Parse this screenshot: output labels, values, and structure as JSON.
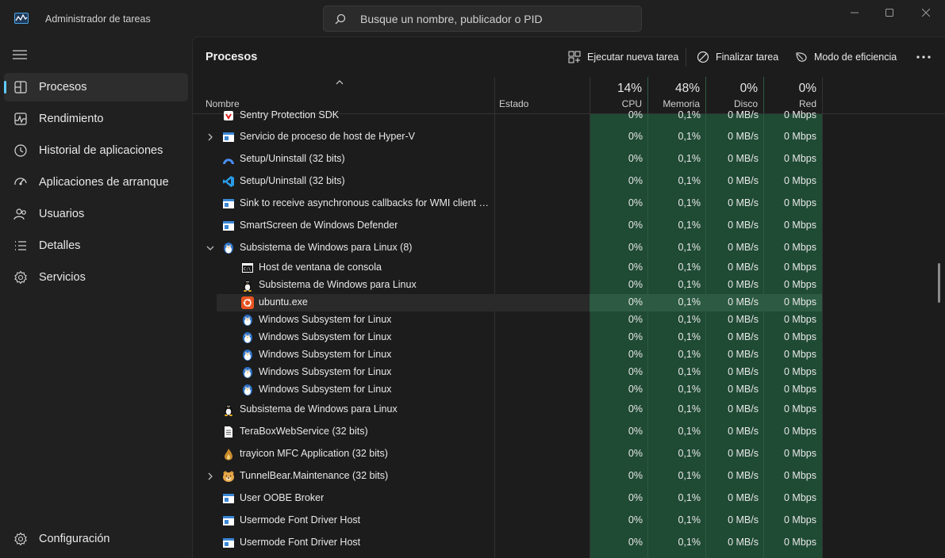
{
  "window": {
    "title": "Administrador de tareas",
    "search_placeholder": "Busque un nombre, publicador o PID"
  },
  "sidebar": {
    "items": [
      {
        "label": "Procesos",
        "icon": "processes-icon",
        "active": true
      },
      {
        "label": "Rendimiento",
        "icon": "performance-icon"
      },
      {
        "label": "Historial de aplicaciones",
        "icon": "app-history-icon"
      },
      {
        "label": "Aplicaciones de arranque",
        "icon": "startup-apps-icon"
      },
      {
        "label": "Usuarios",
        "icon": "users-icon"
      },
      {
        "label": "Detalles",
        "icon": "details-icon"
      },
      {
        "label": "Servicios",
        "icon": "services-icon"
      }
    ],
    "settings_label": "Configuración"
  },
  "toolbar": {
    "title": "Procesos",
    "run_task": "Ejecutar nueva tarea",
    "end_task": "Finalizar tarea",
    "efficiency": "Modo de eficiencia"
  },
  "columns": {
    "name": "Nombre",
    "status": "Estado",
    "cpu": {
      "pct": "14%",
      "label": "CPU"
    },
    "memory": {
      "pct": "48%",
      "label": "Memoria"
    },
    "disk": {
      "pct": "0%",
      "label": "Disco"
    },
    "network": {
      "pct": "0%",
      "label": "Red"
    }
  },
  "rows": [
    {
      "name": "Sentry Protection SDK",
      "icon": "sentry-icon",
      "level": 0,
      "cpu": "0%",
      "mem": "0,1%",
      "disk": "0 MB/s",
      "net": "0 Mbps"
    },
    {
      "name": "Servicio de proceso de host de Hyper-V",
      "icon": "service-window-icon",
      "level": 0,
      "expand": "collapsed",
      "cpu": "0%",
      "mem": "0,1%",
      "disk": "0 MB/s",
      "net": "0 Mbps"
    },
    {
      "name": "Setup/Uninstall (32 bits)",
      "icon": "setup-arc-icon",
      "level": 0,
      "cpu": "0%",
      "mem": "0,1%",
      "disk": "0 MB/s",
      "net": "0 Mbps"
    },
    {
      "name": "Setup/Uninstall (32 bits)",
      "icon": "vscode-icon",
      "level": 0,
      "cpu": "0%",
      "mem": "0,1%",
      "disk": "0 MB/s",
      "net": "0 Mbps"
    },
    {
      "name": "Sink to receive asynchronous callbacks for WMI client app...",
      "icon": "service-window-icon",
      "level": 0,
      "cpu": "0%",
      "mem": "0,1%",
      "disk": "0 MB/s",
      "net": "0 Mbps"
    },
    {
      "name": "SmartScreen de Windows Defender",
      "icon": "service-window-icon",
      "level": 0,
      "cpu": "0%",
      "mem": "0,1%",
      "disk": "0 MB/s",
      "net": "0 Mbps"
    },
    {
      "name": "Subsistema de Windows para Linux (8)",
      "icon": "penguin-icon",
      "level": 0,
      "expand": "expanded",
      "cpu": "0%",
      "mem": "0,1%",
      "disk": "0 MB/s",
      "net": "0 Mbps"
    },
    {
      "name": "Host de ventana de consola",
      "icon": "console-icon",
      "level": 1,
      "cpu": "0%",
      "mem": "0,1%",
      "disk": "0 MB/s",
      "net": "0 Mbps"
    },
    {
      "name": "Subsistema de Windows para Linux",
      "icon": "linux-tux-icon",
      "level": 1,
      "cpu": "0%",
      "mem": "0,1%",
      "disk": "0 MB/s",
      "net": "0 Mbps"
    },
    {
      "name": "ubuntu.exe",
      "icon": "ubuntu-icon",
      "level": 1,
      "highlight": true,
      "cpu": "0%",
      "mem": "0,1%",
      "disk": "0 MB/s",
      "net": "0 Mbps"
    },
    {
      "name": "Windows Subsystem for Linux",
      "icon": "penguin-icon",
      "level": 1,
      "cpu": "0%",
      "mem": "0,1%",
      "disk": "0 MB/s",
      "net": "0 Mbps"
    },
    {
      "name": "Windows Subsystem for Linux",
      "icon": "penguin-icon",
      "level": 1,
      "cpu": "0%",
      "mem": "0,1%",
      "disk": "0 MB/s",
      "net": "0 Mbps"
    },
    {
      "name": "Windows Subsystem for Linux",
      "icon": "penguin-icon",
      "level": 1,
      "cpu": "0%",
      "mem": "0,1%",
      "disk": "0 MB/s",
      "net": "0 Mbps"
    },
    {
      "name": "Windows Subsystem for Linux",
      "icon": "penguin-icon",
      "level": 1,
      "cpu": "0%",
      "mem": "0,1%",
      "disk": "0 MB/s",
      "net": "0 Mbps"
    },
    {
      "name": "Windows Subsystem for Linux",
      "icon": "penguin-icon",
      "level": 1,
      "cpu": "0%",
      "mem": "0,1%",
      "disk": "0 MB/s",
      "net": "0 Mbps"
    },
    {
      "name": "Subsistema de Windows para Linux",
      "icon": "linux-tux-icon",
      "level": 0,
      "cpu": "0%",
      "mem": "0,1%",
      "disk": "0 MB/s",
      "net": "0 Mbps"
    },
    {
      "name": "TeraBoxWebService (32 bits)",
      "icon": "document-icon",
      "level": 0,
      "cpu": "0%",
      "mem": "0,1%",
      "disk": "0 MB/s",
      "net": "0 Mbps"
    },
    {
      "name": "trayicon MFC Application (32 bits)",
      "icon": "flame-icon",
      "level": 0,
      "cpu": "0%",
      "mem": "0,1%",
      "disk": "0 MB/s",
      "net": "0 Mbps"
    },
    {
      "name": "TunnelBear.Maintenance (32 bits)",
      "icon": "tunnelbear-icon",
      "level": 0,
      "expand": "collapsed",
      "cpu": "0%",
      "mem": "0,1%",
      "disk": "0 MB/s",
      "net": "0 Mbps"
    },
    {
      "name": "User OOBE Broker",
      "icon": "service-window-icon",
      "level": 0,
      "cpu": "0%",
      "mem": "0,1%",
      "disk": "0 MB/s",
      "net": "0 Mbps"
    },
    {
      "name": "Usermode Font Driver Host",
      "icon": "service-window-icon",
      "level": 0,
      "cpu": "0%",
      "mem": "0,1%",
      "disk": "0 MB/s",
      "net": "0 Mbps"
    },
    {
      "name": "Usermode Font Driver Host",
      "icon": "service-window-icon",
      "level": 0,
      "cpu": "0%",
      "mem": "0,1%",
      "disk": "0 MB/s",
      "net": "0 Mbps"
    }
  ],
  "colors": {
    "accent": "#60cdff",
    "cpu_heat": "#1f4a34",
    "background": "#202020"
  }
}
